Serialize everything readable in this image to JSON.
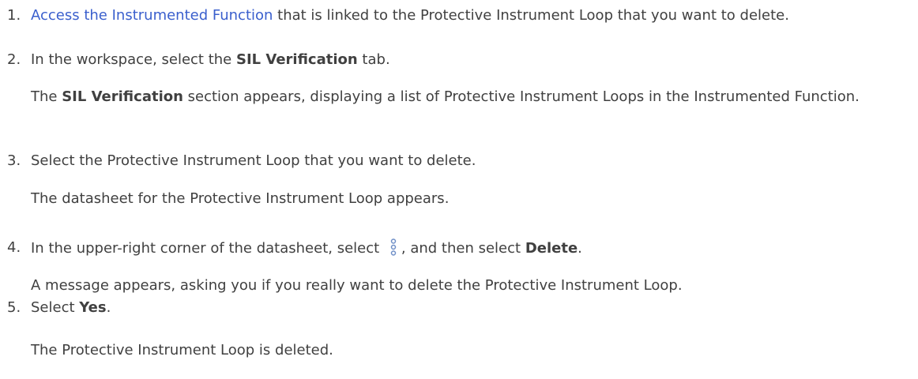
{
  "steps": [
    {
      "num": "1.",
      "link_text": "Access the Instrumented Function",
      "text": " that is linked to the Protective Instrument Loop that you want to delete."
    },
    {
      "num": "2.",
      "pre": "In the workspace, select the ",
      "bold": "SIL Verification",
      "post": " tab.",
      "result_bold": "The ",
      "result_bold_term": "SIL Verification",
      "result_post": " section appears, displaying a list of Protective Instrument Loops in the Instrumented Function."
    },
    {
      "num": "3.",
      "text": "Select the Protective Instrument Loop that you want to delete.",
      "result": "The datasheet for the Protective Instrument Loop appears."
    },
    {
      "num": "4.",
      "pre": "In the upper-right corner of the datasheet, select ",
      "mid": ", and then select ",
      "bold": "Delete",
      "post": ".",
      "icon": "more-options-icon",
      "result": "A message appears, asking you if you really want to delete the Protective Instrument Loop."
    },
    {
      "num": "5.",
      "pre": "Select ",
      "bold": "Yes",
      "post": ".",
      "result": "The Protective Instrument Loop is deleted."
    }
  ],
  "colors": {
    "text": "#404040",
    "link": "#3a5fcd",
    "icon": "#6f8fc7"
  }
}
